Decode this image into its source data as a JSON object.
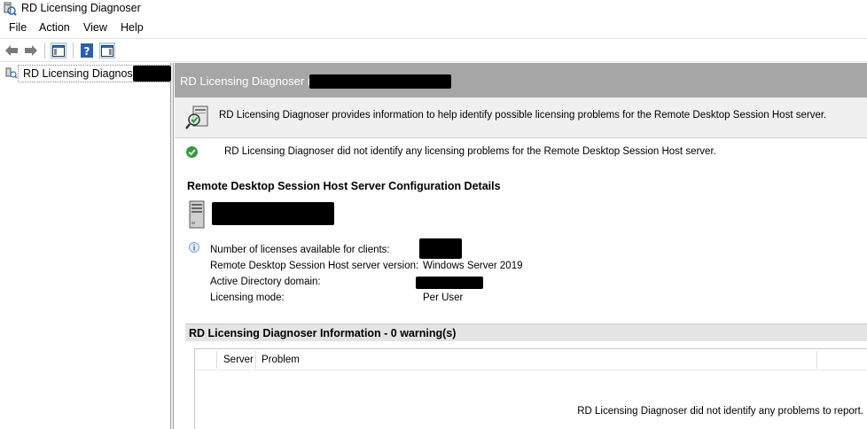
{
  "window": {
    "title": "RD Licensing Diagnoser",
    "app_icon": "rd-licensing-icon"
  },
  "menu": {
    "items": [
      "File",
      "Action",
      "View",
      "Help"
    ]
  },
  "toolbar": {
    "icons": [
      "back-arrow-icon",
      "forward-arrow-icon",
      "show-hide-console-tree-icon",
      "help-icon",
      "show-hide-action-pane-icon"
    ]
  },
  "tree": {
    "root_label": "RD Licensing Diagnoser"
  },
  "content": {
    "header_title": "RD Licensing Diagnoser (",
    "info_text": "RD Licensing Diagnoser provides information to help identify possible licensing problems for the Remote Desktop Session Host server.",
    "status_text": "RD Licensing Diagnoser did not identify any licensing problems for the Remote Desktop Session Host server.",
    "section_title": "Remote Desktop Session Host Server Configuration Details",
    "details": [
      {
        "label": "Number of licenses available for clients:",
        "value": ""
      },
      {
        "label": "Remote Desktop Session Host server version:",
        "value": "Windows Server 2019"
      },
      {
        "label": "Active Directory domain:",
        "value": ""
      },
      {
        "label": "Licensing mode:",
        "value": "Per User"
      }
    ],
    "warnings_title": "RD Licensing Diagnoser Information - 0 warning(s)",
    "columns": [
      "Server",
      "Problem"
    ],
    "empty_message": "RD Licensing Diagnoser did not identify any problems to report."
  },
  "colors": {
    "header_bg": "#a6a6a6",
    "status_ok": "#2e9e3a",
    "redaction": "#000000"
  }
}
